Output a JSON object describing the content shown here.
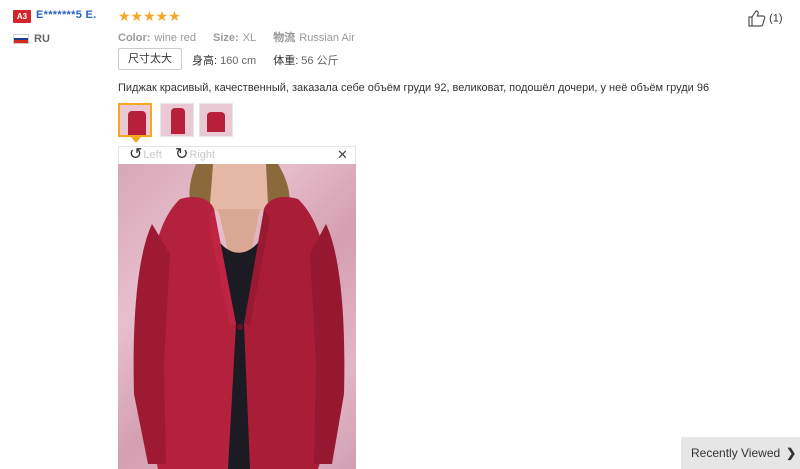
{
  "reviewer": {
    "level": "A3",
    "name": "E*******5 E.",
    "country": "RU",
    "flag_colors": [
      "#ffffff",
      "#1c3f95",
      "#d52b1e"
    ]
  },
  "rating": {
    "stars": "★★★★★",
    "value": 5,
    "max": 5,
    "color": "#f5a623"
  },
  "attributes": [
    {
      "label": "Color:",
      "value": "wine red"
    },
    {
      "label": "Size:",
      "value": "XL"
    },
    {
      "label": "物流",
      "value": "Russian Air"
    }
  ],
  "size_feedback": "尺寸太大",
  "body_info": [
    {
      "label": "身高:",
      "value": "160 cm"
    },
    {
      "label": "体重:",
      "value": "56 公斤"
    }
  ],
  "review_text": "Пиджак красивый, качественный, заказала себе объём груди 92, великоват, подошёл дочери, у неё объём груди 96",
  "viewer": {
    "rotate_left_label": "Left",
    "rotate_right_label": "Right",
    "rotate_left_icon": "rotate-left-icon",
    "rotate_right_icon": "rotate-right-icon",
    "close_icon": "close-icon",
    "close_glyph": "✕"
  },
  "like": {
    "icon": "thumbs-up-icon",
    "count": "(1)"
  },
  "recently_viewed": {
    "label": "Recently Viewed",
    "chevron": "❯"
  },
  "colors": {
    "accent": "#f5a623",
    "name_blue": "#2b64c0",
    "badge_red": "#d0262b",
    "jacket": "#b81f3a"
  }
}
